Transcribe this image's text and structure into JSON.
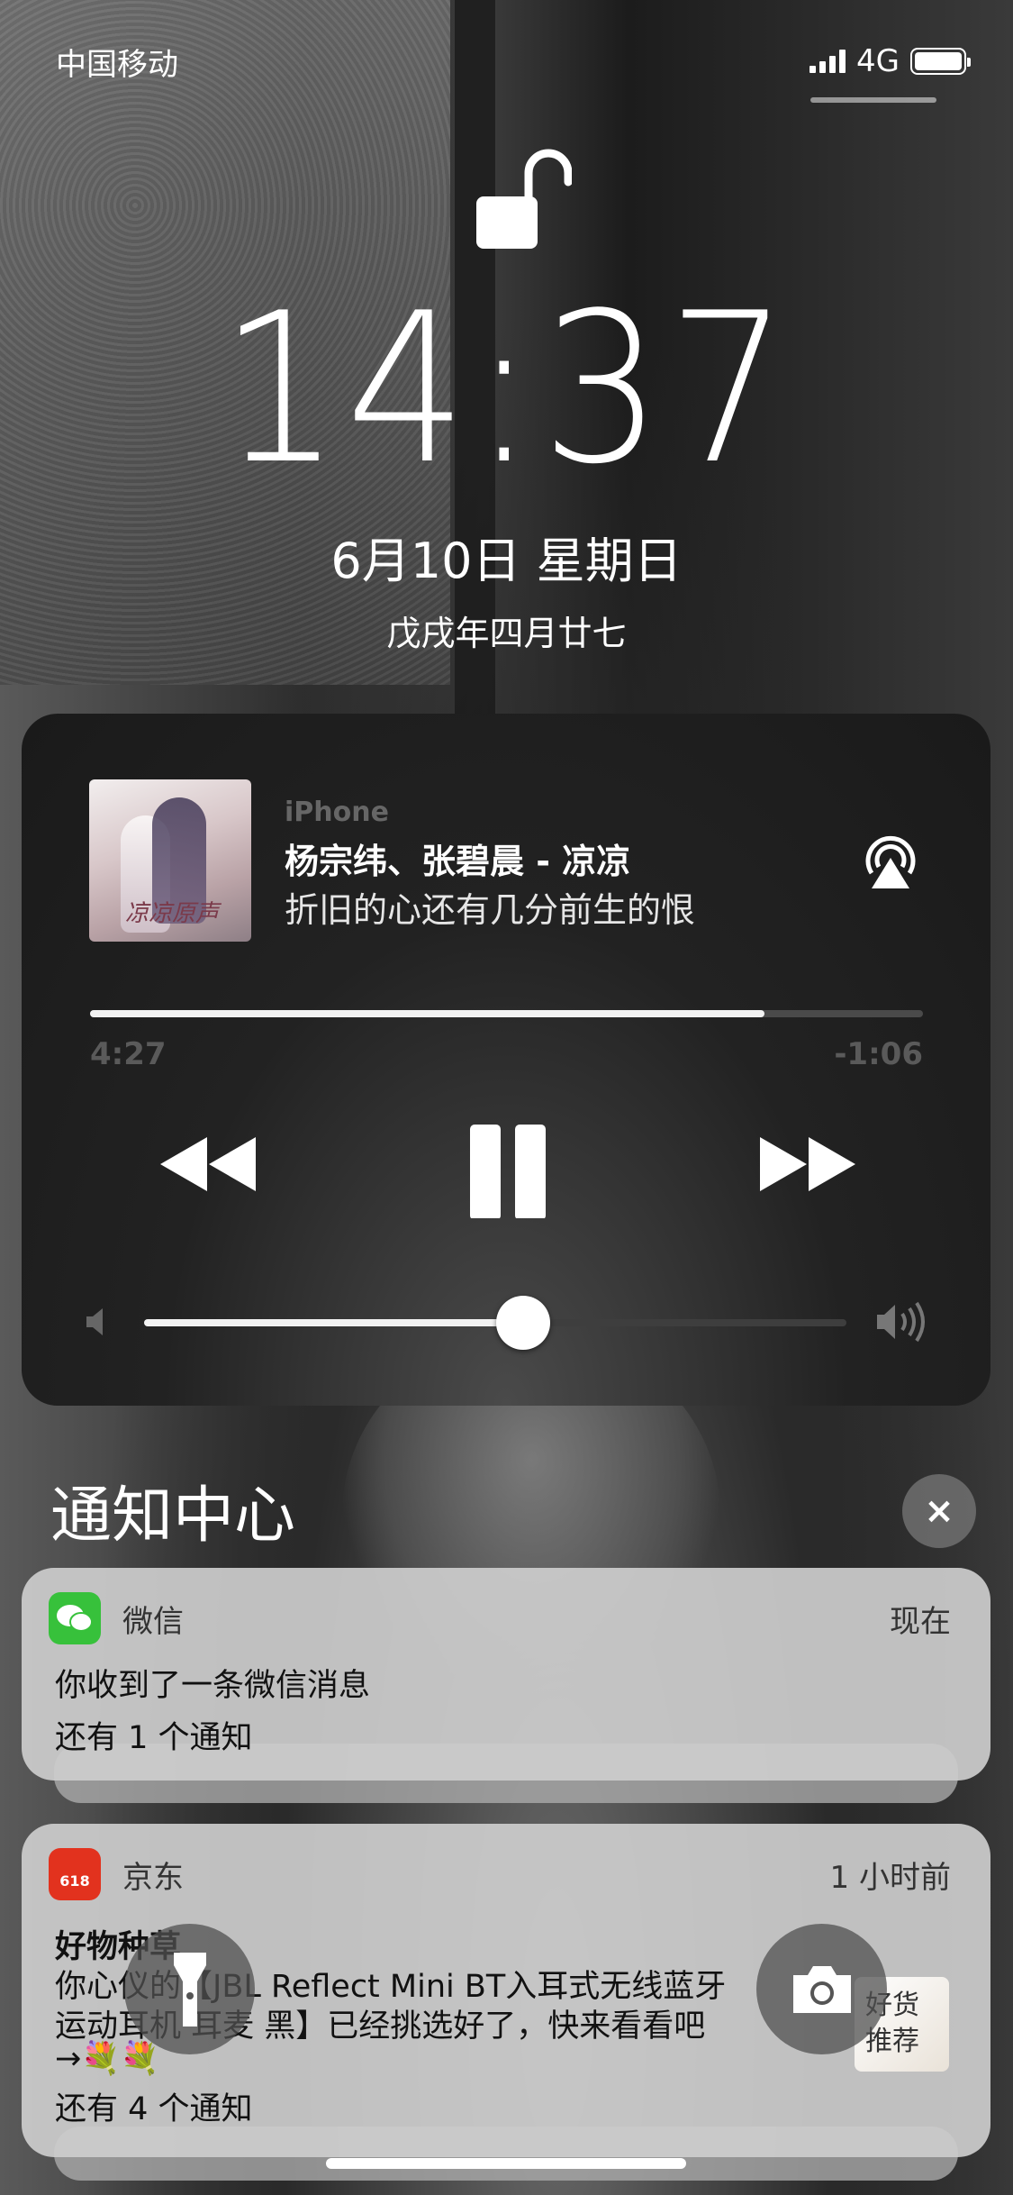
{
  "status_bar": {
    "carrier": "中国移动",
    "network": "4G"
  },
  "lock_screen": {
    "time": "14:37",
    "date": "6月10日 星期日",
    "lunar_date": "戊戌年四月廿七"
  },
  "now_playing": {
    "source": "iPhone",
    "title": "杨宗纬、张碧晨 - 凉凉",
    "lyric": "折旧的心还有几分前生的恨",
    "art_text": "凉凉原声",
    "elapsed": "4:27",
    "remaining": "-1:06",
    "progress_fraction": 0.81,
    "volume_fraction": 0.54
  },
  "notification_center": {
    "title": "通知中心",
    "close_icon": "×",
    "notifications": [
      {
        "app": "微信",
        "time": "现在",
        "message": "你收到了一条微信消息",
        "more": "还有 1 个通知"
      },
      {
        "app": "京东",
        "time": "1 小时前",
        "title": "好物种草",
        "line1": "你心仪的【JBL Reflect Mini BT入耳式无线蓝牙",
        "line2": "运动耳机 耳麦 黑】已经挑选好了，快来看看吧",
        "line3": "→💐💐",
        "more": "还有 4 个通知",
        "thumb_text": "好货推荐",
        "icon_badge": "618"
      }
    ]
  },
  "quick_actions": {
    "flashlight": "flashlight-icon",
    "camera": "camera-icon"
  },
  "colors": {
    "wechat": "#37c13b",
    "jd": "#e2321e"
  }
}
